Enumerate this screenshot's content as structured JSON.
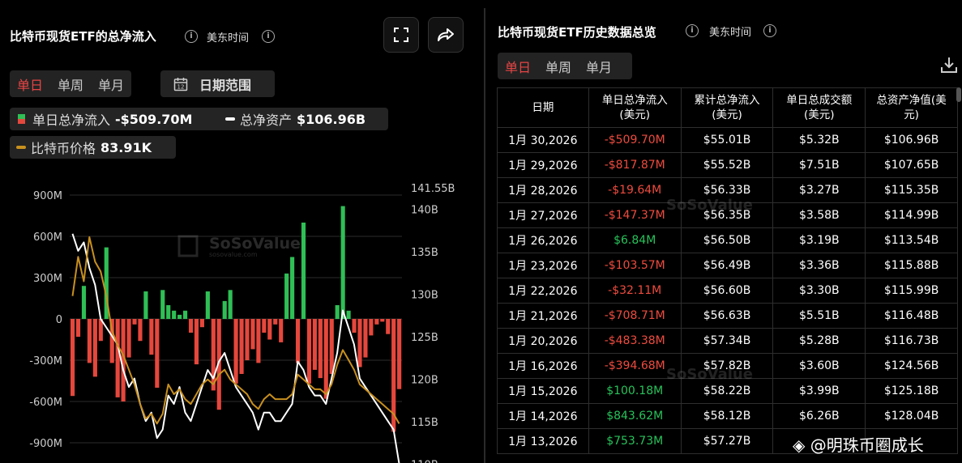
{
  "left": {
    "title": "比特币现货ETF的总净流入",
    "timezone": "美东时间",
    "tabs": [
      "单日",
      "单周",
      "单月"
    ],
    "date_range_label": "日期范围",
    "legend": {
      "daily_inflow_label": "单日总净流入",
      "daily_inflow_value": "-$509.70M",
      "net_assets_label": "总净资产",
      "net_assets_value": "$106.96B",
      "btc_price_label": "比特币价格",
      "btc_price_value": "83.91K"
    },
    "watermark": {
      "brand": "SoSoValue",
      "site": "sosovalue.com"
    }
  },
  "right": {
    "title": "比特币现货ETF历史数据总览",
    "timezone": "美东时间",
    "tabs": [
      "单日",
      "单周",
      "单月"
    ],
    "headers": {
      "date": "日期",
      "daily_inflow": [
        "单日总净流入",
        "(美元)"
      ],
      "cumulative_inflow": [
        "累计总净流入",
        "(美元)"
      ],
      "daily_volume": [
        "单日总成交额",
        "(美元)"
      ],
      "net_assets": [
        "总资产净值(美",
        "元)"
      ]
    },
    "rows": [
      [
        "1月 30,2026",
        "-$509.70M",
        "$55.01B",
        "$5.32B",
        "$106.96B"
      ],
      [
        "1月 29,2026",
        "-$817.87M",
        "$55.52B",
        "$7.51B",
        "$107.65B"
      ],
      [
        "1月 28,2026",
        "-$19.64M",
        "$56.33B",
        "$3.27B",
        "$115.35B"
      ],
      [
        "1月 27,2026",
        "-$147.37M",
        "$56.35B",
        "$3.58B",
        "$114.99B"
      ],
      [
        "1月 26,2026",
        "$6.84M",
        "$56.50B",
        "$3.19B",
        "$113.54B"
      ],
      [
        "1月 23,2026",
        "-$103.57M",
        "$56.49B",
        "$3.36B",
        "$115.88B"
      ],
      [
        "1月 22,2026",
        "-$32.11M",
        "$56.60B",
        "$3.30B",
        "$115.99B"
      ],
      [
        "1月 21,2026",
        "-$708.71M",
        "$56.63B",
        "$5.51B",
        "$116.48B"
      ],
      [
        "1月 20,2026",
        "-$483.38M",
        "$57.34B",
        "$5.28B",
        "$116.73B"
      ],
      [
        "1月 16,2026",
        "-$394.68M",
        "$57.82B",
        "$3.60B",
        "$124.56B"
      ],
      [
        "1月 15,2026",
        "$100.18M",
        "$58.22B",
        "$3.99B",
        "$125.18B"
      ],
      [
        "1月 14,2026",
        "$843.62M",
        "$58.12B",
        "$6.26B",
        "$128.04B"
      ],
      [
        "1月 13,2026",
        "$753.73M",
        "$57.27B",
        "",
        ""
      ]
    ],
    "overlay_text": "@明珠币圈成长",
    "colors": {
      "negative": "#ee4b3e",
      "positive": "#27c35a",
      "accent": "#e84545"
    }
  },
  "chart_data": {
    "type": "bar",
    "title": "",
    "ylabel": "",
    "y_left_ticks": [
      "900M",
      "600M",
      "300M",
      "0",
      "-300M",
      "-600M",
      "-900M"
    ],
    "y_right_ticks": [
      "141.55B",
      "140B",
      "135B",
      "130B",
      "125B",
      "120B",
      "115B",
      "110B"
    ],
    "ylim_left": [
      -960,
      960
    ],
    "ylim_right": [
      109.5,
      141.55
    ],
    "price_range": [
      75,
      125
    ],
    "series": [
      {
        "name": "单日总净流入",
        "unit": "M",
        "values": [
          -560,
          -130,
          240,
          -320,
          -420,
          -160,
          520,
          -320,
          -570,
          -600,
          -280,
          -40,
          -160,
          200,
          -260,
          -500,
          210,
          100,
          60,
          30,
          60,
          -100,
          -330,
          -60,
          200,
          -520,
          -660,
          130,
          210,
          -470,
          -400,
          -300,
          -220,
          -320,
          -100,
          -150,
          -40,
          -170,
          330,
          450,
          -320,
          700,
          -470,
          -370,
          -430,
          -580,
          -400,
          100,
          820,
          60,
          -100,
          -350,
          -280,
          -120,
          -40,
          -20,
          -110,
          -820,
          -510
        ]
      },
      {
        "name": "总净资产",
        "unit": "B",
        "values": [
          137,
          135,
          136,
          133,
          131,
          127,
          126,
          125,
          124,
          121,
          119,
          120,
          117,
          115,
          116,
          113,
          114,
          118,
          117,
          119,
          116,
          115,
          117,
          119,
          121,
          120,
          122,
          123,
          121,
          119,
          118,
          117,
          116,
          114,
          116,
          116,
          115,
          115,
          116,
          117,
          122,
          121,
          119,
          118,
          118,
          117,
          120,
          123,
          128,
          126,
          124,
          120,
          119,
          118,
          117,
          116,
          115,
          114,
          110
        ]
      },
      {
        "name": "比特币价格",
        "unit": "K",
        "values": [
          110,
          118,
          113,
          122,
          117,
          115,
          110,
          103,
          100,
          98,
          95,
          92,
          88,
          85,
          86,
          84,
          86,
          92,
          90,
          91,
          89,
          88,
          90,
          92,
          93,
          92,
          94,
          95,
          93,
          92,
          91,
          90,
          88,
          87,
          89,
          90,
          89,
          89,
          89,
          90,
          94,
          93,
          92,
          91,
          91,
          90,
          92,
          96,
          99,
          97,
          95,
          92,
          91,
          90,
          89,
          88,
          87,
          86,
          84
        ]
      }
    ],
    "colors": {
      "inflow": "#2fbf55",
      "outflow": "#e5473c",
      "net_assets": "#ffffff",
      "btc_price": "#c8901e"
    }
  }
}
